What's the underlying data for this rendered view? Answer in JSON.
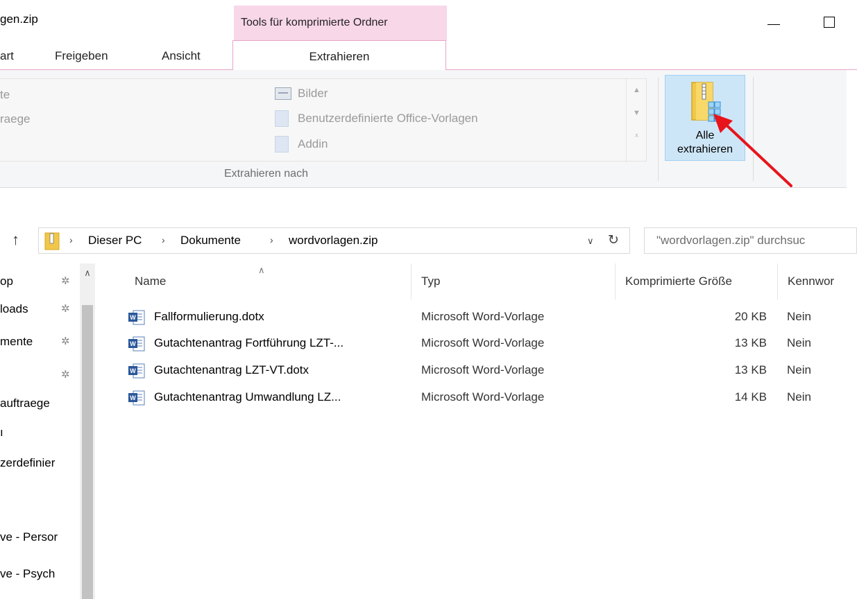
{
  "window": {
    "title": "gen.zip",
    "context_tab_group": "Tools für komprimierte Ordner"
  },
  "ribbon_tabs": [
    {
      "label": "art"
    },
    {
      "label": "Freigeben"
    },
    {
      "label": "Ansicht"
    },
    {
      "label": "Extrahieren"
    }
  ],
  "ribbon": {
    "gallery_left": [
      "te",
      "raege"
    ],
    "gallery_items": [
      {
        "label": "Bilder",
        "icon": "pictures-folder-icon"
      },
      {
        "label": "Benutzerdefinierte Office-Vorlagen",
        "icon": "document-icon"
      },
      {
        "label": "Addin",
        "icon": "document-icon"
      }
    ],
    "group_label": "Extrahieren nach",
    "extract_all": {
      "line1": "Alle",
      "line2": "extrahieren"
    }
  },
  "address_bar": {
    "crumbs": [
      "Dieser PC",
      "Dokumente",
      "wordvorlagen.zip"
    ],
    "search_placeholder": "\"wordvorlagen.zip\" durchsuc"
  },
  "nav_pane": {
    "items": [
      {
        "label": "op",
        "pinned": true
      },
      {
        "label": "loads",
        "pinned": true
      },
      {
        "label": "mente",
        "pinned": true
      },
      {
        "label": "",
        "pinned": true
      },
      {
        "label": "auftraege",
        "pinned": false
      },
      {
        "label": "",
        "pinned": false
      },
      {
        "label": "zerdefinier",
        "pinned": false
      },
      {
        "label": "ve - Persor",
        "pinned": false
      },
      {
        "label": "ve - Psych",
        "pinned": false
      }
    ]
  },
  "file_list": {
    "columns": {
      "name": "Name",
      "type": "Typ",
      "size": "Komprimierte Größe",
      "password": "Kennwor"
    },
    "rows": [
      {
        "name": "Fallformulierung.dotx",
        "type": "Microsoft Word-Vorlage",
        "size": "20 KB",
        "password": "Nein"
      },
      {
        "name": "Gutachtenantrag Fortführung LZT-...",
        "type": "Microsoft Word-Vorlage",
        "size": "13 KB",
        "password": "Nein"
      },
      {
        "name": "Gutachtenantrag LZT-VT.dotx",
        "type": "Microsoft Word-Vorlage",
        "size": "13 KB",
        "password": "Nein"
      },
      {
        "name": "Gutachtenantrag Umwandlung LZ...",
        "type": "Microsoft Word-Vorlage",
        "size": "14 KB",
        "password": "Nein"
      }
    ]
  },
  "colors": {
    "context_tab": "#f8d7e9",
    "tab_border": "#e9a3c9",
    "extract_highlight": "#cde6f7",
    "arrow": "#e8141c"
  }
}
